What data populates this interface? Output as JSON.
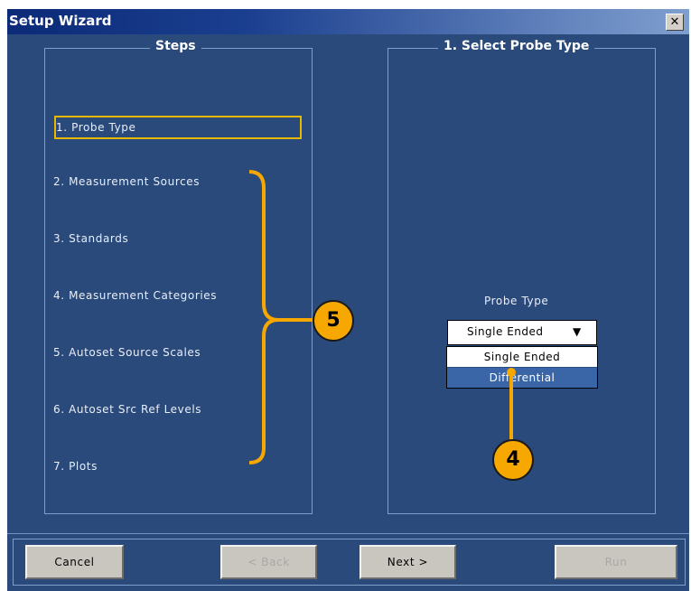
{
  "window": {
    "title": "Setup Wizard",
    "close_label": "✕"
  },
  "steps_panel": {
    "title": "Steps",
    "items": [
      {
        "label": "1. Probe Type",
        "active": true
      },
      {
        "label": "2. Measurement Sources"
      },
      {
        "label": "3. Standards"
      },
      {
        "label": "4. Measurement Categories"
      },
      {
        "label": "5. Autoset Source Scales"
      },
      {
        "label": "6. Autoset Src Ref Levels"
      },
      {
        "label": "7. Plots"
      }
    ]
  },
  "probe_panel": {
    "title": "1. Select Probe Type",
    "field_label": "Probe Type",
    "selected_value": "Single Ended",
    "options": [
      "Single Ended",
      "Differential"
    ],
    "highlighted_option": "Differential"
  },
  "callouts": {
    "steps": "5",
    "dropdown": "4"
  },
  "buttons": {
    "cancel": "Cancel",
    "back": "< Back",
    "next": "Next >",
    "run": "Run"
  },
  "colors": {
    "background": "#294a7a",
    "highlight_border": "#e6b800",
    "callout": "#f7a800",
    "selected_option": "#3a66a8"
  }
}
